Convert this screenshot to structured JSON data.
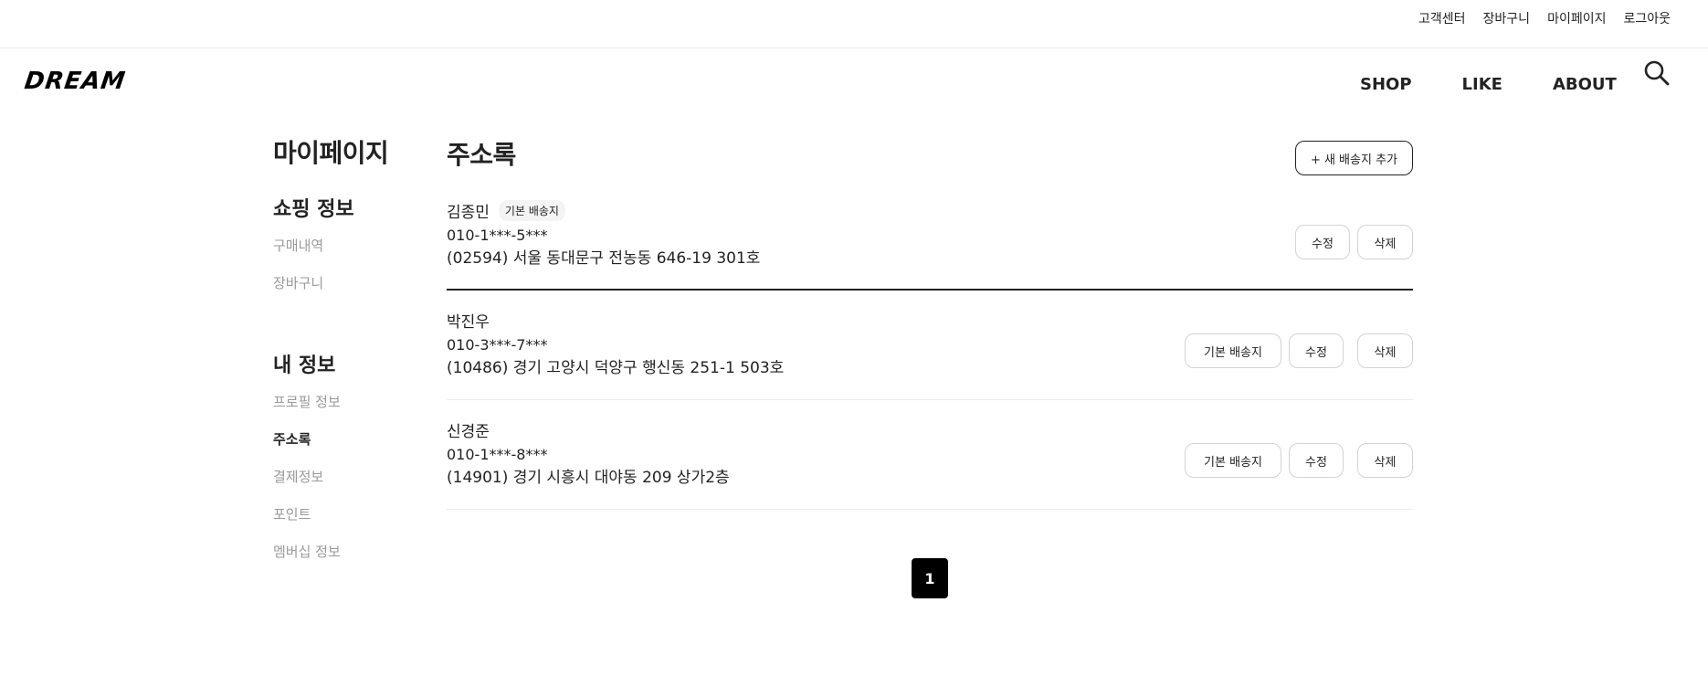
{
  "top_links": [
    "고객센터",
    "장바구니",
    "마이페이지",
    "로그아웃"
  ],
  "header": {
    "logo": "DREAM",
    "nav": [
      "SHOP",
      "LIKE",
      "ABOUT"
    ],
    "search_icon": "search-icon"
  },
  "sidebar": {
    "title": "마이페이지",
    "groups": [
      {
        "title": "쇼핑 정보",
        "items": [
          "구매내역",
          "장바구니"
        ]
      },
      {
        "title": "내 정보",
        "items": [
          "프로필 정보",
          "주소록",
          "결제정보",
          "포인트",
          "멤버십 정보"
        ]
      }
    ],
    "active_item": "주소록"
  },
  "content": {
    "title": "주소록",
    "add_button": "+ 새 배송지 추가",
    "default_badge": "기본 배송지",
    "buttons": {
      "set_default": "기본 배송지",
      "edit": "수정",
      "delete": "삭제"
    },
    "addresses": [
      {
        "name": "김종민",
        "phone": "010-1***-5***",
        "address": "(02594) 서울 동대문구 전농동 646-19 301호",
        "is_default": true
      },
      {
        "name": "박진우",
        "phone": "010-3***-7***",
        "address": "(10486) 경기 고양시 덕양구 행신동 251-1 503호",
        "is_default": false
      },
      {
        "name": "신경준",
        "phone": "010-1***-8***",
        "address": "(14901) 경기 시흥시 대야동 209 상가2층",
        "is_default": false
      }
    ]
  },
  "pagination": {
    "current": "1"
  },
  "colors": {
    "text": "#222222",
    "muted": "#9a9a9a",
    "border": "#ebebeb",
    "active_page": "#000000"
  }
}
